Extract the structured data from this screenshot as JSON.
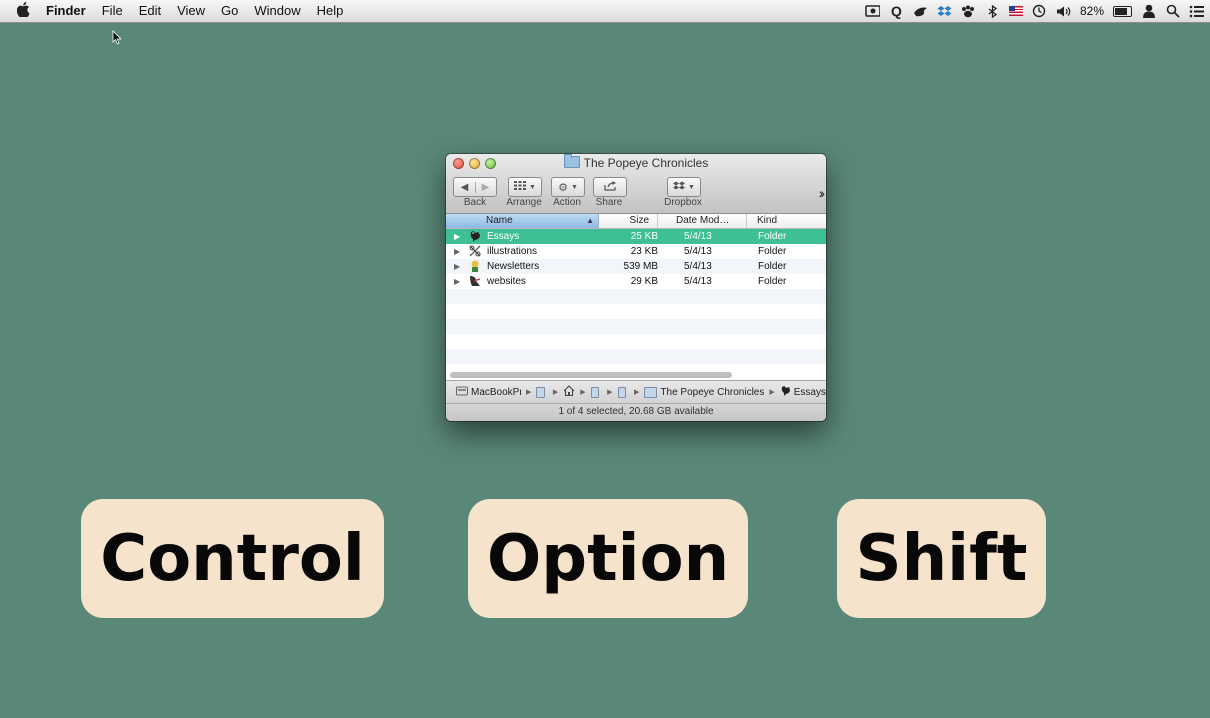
{
  "menubar": {
    "app_name": "Finder",
    "items": [
      "File",
      "Edit",
      "View",
      "Go",
      "Window",
      "Help"
    ],
    "battery_percent": "82%"
  },
  "window": {
    "title": "The Popeye Chronicles",
    "toolbar": {
      "back_label": "Back",
      "arrange_label": "Arrange",
      "action_label": "Action",
      "share_label": "Share",
      "dropbox_label": "Dropbox"
    },
    "columns": {
      "name": "Name",
      "size": "Size",
      "date": "Date Mod…",
      "kind": "Kind"
    },
    "rows": [
      {
        "name": "Essays",
        "size": "25 KB",
        "date": "5/4/13",
        "kind": "Folder",
        "selected": true
      },
      {
        "name": "illustrations",
        "size": "23 KB",
        "date": "5/4/13",
        "kind": "Folder",
        "selected": false
      },
      {
        "name": "Newsletters",
        "size": "539 MB",
        "date": "5/4/13",
        "kind": "Folder",
        "selected": false
      },
      {
        "name": "websites",
        "size": "29 KB",
        "date": "5/4/13",
        "kind": "Folder",
        "selected": false
      }
    ],
    "path": {
      "root": "MacBookPr",
      "parent": "The Popeye Chronicles",
      "current": "Essays"
    },
    "status": "1 of 4 selected, 20.68 GB available"
  },
  "keys": {
    "control": "Control",
    "option": "Option",
    "shift": "Shift"
  },
  "colors": {
    "desktop": "#5a8878",
    "selection": "#3fbf95",
    "keycap": "#f6e3cb"
  }
}
